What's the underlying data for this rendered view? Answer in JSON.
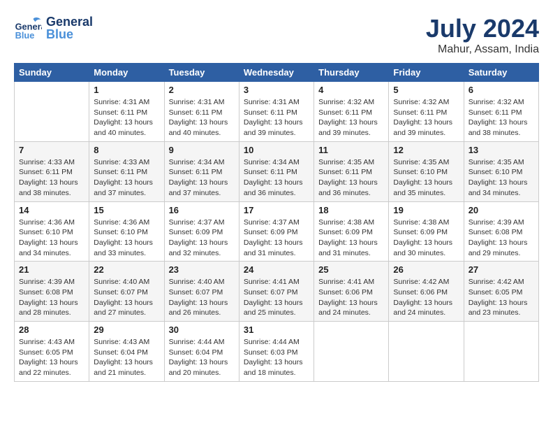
{
  "header": {
    "logo_general": "General",
    "logo_blue": "Blue",
    "title": "July 2024",
    "subtitle": "Mahur, Assam, India"
  },
  "days_of_week": [
    "Sunday",
    "Monday",
    "Tuesday",
    "Wednesday",
    "Thursday",
    "Friday",
    "Saturday"
  ],
  "weeks": [
    [
      {
        "day": "",
        "info": ""
      },
      {
        "day": "1",
        "info": "Sunrise: 4:31 AM\nSunset: 6:11 PM\nDaylight: 13 hours\nand 40 minutes."
      },
      {
        "day": "2",
        "info": "Sunrise: 4:31 AM\nSunset: 6:11 PM\nDaylight: 13 hours\nand 40 minutes."
      },
      {
        "day": "3",
        "info": "Sunrise: 4:31 AM\nSunset: 6:11 PM\nDaylight: 13 hours\nand 39 minutes."
      },
      {
        "day": "4",
        "info": "Sunrise: 4:32 AM\nSunset: 6:11 PM\nDaylight: 13 hours\nand 39 minutes."
      },
      {
        "day": "5",
        "info": "Sunrise: 4:32 AM\nSunset: 6:11 PM\nDaylight: 13 hours\nand 39 minutes."
      },
      {
        "day": "6",
        "info": "Sunrise: 4:32 AM\nSunset: 6:11 PM\nDaylight: 13 hours\nand 38 minutes."
      }
    ],
    [
      {
        "day": "7",
        "info": "Sunrise: 4:33 AM\nSunset: 6:11 PM\nDaylight: 13 hours\nand 38 minutes."
      },
      {
        "day": "8",
        "info": "Sunrise: 4:33 AM\nSunset: 6:11 PM\nDaylight: 13 hours\nand 37 minutes."
      },
      {
        "day": "9",
        "info": "Sunrise: 4:34 AM\nSunset: 6:11 PM\nDaylight: 13 hours\nand 37 minutes."
      },
      {
        "day": "10",
        "info": "Sunrise: 4:34 AM\nSunset: 6:11 PM\nDaylight: 13 hours\nand 36 minutes."
      },
      {
        "day": "11",
        "info": "Sunrise: 4:35 AM\nSunset: 6:11 PM\nDaylight: 13 hours\nand 36 minutes."
      },
      {
        "day": "12",
        "info": "Sunrise: 4:35 AM\nSunset: 6:10 PM\nDaylight: 13 hours\nand 35 minutes."
      },
      {
        "day": "13",
        "info": "Sunrise: 4:35 AM\nSunset: 6:10 PM\nDaylight: 13 hours\nand 34 minutes."
      }
    ],
    [
      {
        "day": "14",
        "info": "Sunrise: 4:36 AM\nSunset: 6:10 PM\nDaylight: 13 hours\nand 34 minutes."
      },
      {
        "day": "15",
        "info": "Sunrise: 4:36 AM\nSunset: 6:10 PM\nDaylight: 13 hours\nand 33 minutes."
      },
      {
        "day": "16",
        "info": "Sunrise: 4:37 AM\nSunset: 6:09 PM\nDaylight: 13 hours\nand 32 minutes."
      },
      {
        "day": "17",
        "info": "Sunrise: 4:37 AM\nSunset: 6:09 PM\nDaylight: 13 hours\nand 31 minutes."
      },
      {
        "day": "18",
        "info": "Sunrise: 4:38 AM\nSunset: 6:09 PM\nDaylight: 13 hours\nand 31 minutes."
      },
      {
        "day": "19",
        "info": "Sunrise: 4:38 AM\nSunset: 6:09 PM\nDaylight: 13 hours\nand 30 minutes."
      },
      {
        "day": "20",
        "info": "Sunrise: 4:39 AM\nSunset: 6:08 PM\nDaylight: 13 hours\nand 29 minutes."
      }
    ],
    [
      {
        "day": "21",
        "info": "Sunrise: 4:39 AM\nSunset: 6:08 PM\nDaylight: 13 hours\nand 28 minutes."
      },
      {
        "day": "22",
        "info": "Sunrise: 4:40 AM\nSunset: 6:07 PM\nDaylight: 13 hours\nand 27 minutes."
      },
      {
        "day": "23",
        "info": "Sunrise: 4:40 AM\nSunset: 6:07 PM\nDaylight: 13 hours\nand 26 minutes."
      },
      {
        "day": "24",
        "info": "Sunrise: 4:41 AM\nSunset: 6:07 PM\nDaylight: 13 hours\nand 25 minutes."
      },
      {
        "day": "25",
        "info": "Sunrise: 4:41 AM\nSunset: 6:06 PM\nDaylight: 13 hours\nand 24 minutes."
      },
      {
        "day": "26",
        "info": "Sunrise: 4:42 AM\nSunset: 6:06 PM\nDaylight: 13 hours\nand 24 minutes."
      },
      {
        "day": "27",
        "info": "Sunrise: 4:42 AM\nSunset: 6:05 PM\nDaylight: 13 hours\nand 23 minutes."
      }
    ],
    [
      {
        "day": "28",
        "info": "Sunrise: 4:43 AM\nSunset: 6:05 PM\nDaylight: 13 hours\nand 22 minutes."
      },
      {
        "day": "29",
        "info": "Sunrise: 4:43 AM\nSunset: 6:04 PM\nDaylight: 13 hours\nand 21 minutes."
      },
      {
        "day": "30",
        "info": "Sunrise: 4:44 AM\nSunset: 6:04 PM\nDaylight: 13 hours\nand 20 minutes."
      },
      {
        "day": "31",
        "info": "Sunrise: 4:44 AM\nSunset: 6:03 PM\nDaylight: 13 hours\nand 18 minutes."
      },
      {
        "day": "",
        "info": ""
      },
      {
        "day": "",
        "info": ""
      },
      {
        "day": "",
        "info": ""
      }
    ]
  ]
}
